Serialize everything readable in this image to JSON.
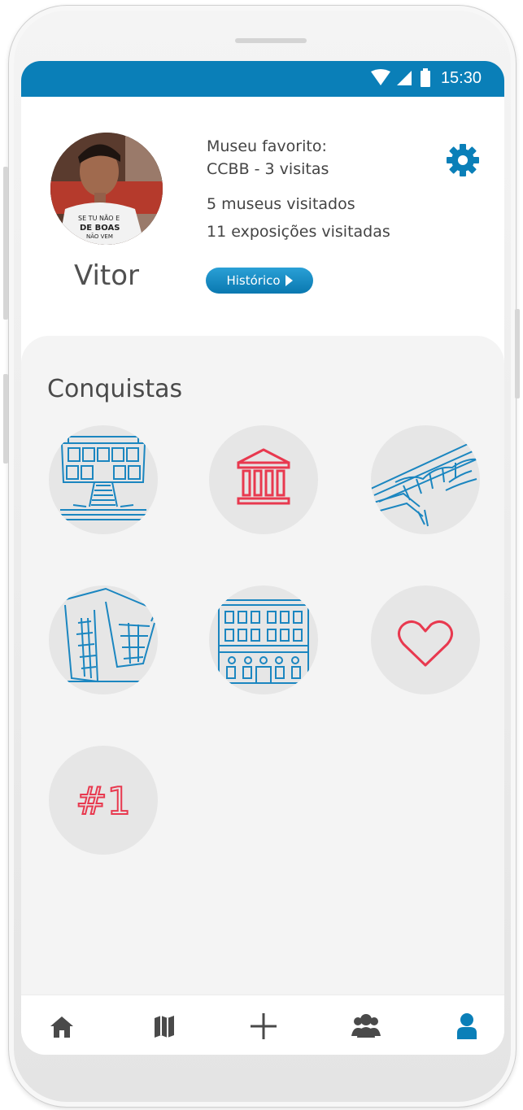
{
  "status_bar": {
    "time": "15:30"
  },
  "profile": {
    "name": "Vitor",
    "favorite_label": "Museu favorito:",
    "favorite_value": "CCBB - 3 visitas",
    "museums_visited": "5 museus visitados",
    "exhibitions_visited": "11 exposições visitadas",
    "history_button": "Histórico",
    "avatar_shirt_text": [
      "SE TU NÃO E",
      "DE BOAS",
      "NÃO VEM"
    ]
  },
  "achievements": {
    "title": "Conquistas",
    "items": [
      {
        "name": "badge-building-stairs"
      },
      {
        "name": "badge-museum-columns"
      },
      {
        "name": "badge-modern-roof"
      },
      {
        "name": "badge-glass-building"
      },
      {
        "name": "badge-classic-facade"
      },
      {
        "name": "badge-heart"
      },
      {
        "name": "badge-number-one",
        "text": "#1"
      }
    ]
  },
  "nav": {
    "items": [
      {
        "icon": "home-icon"
      },
      {
        "icon": "map-icon"
      },
      {
        "icon": "plus-icon"
      },
      {
        "icon": "group-icon"
      },
      {
        "icon": "profile-icon",
        "active": true
      }
    ]
  },
  "colors": {
    "primary": "#0a7fb8",
    "line_art": "#1b86c0",
    "accent_red": "#e8394f",
    "badge_bg": "#e6e6e6",
    "panel_bg": "#f4f4f4",
    "nav_icon": "#4a4a4a"
  }
}
